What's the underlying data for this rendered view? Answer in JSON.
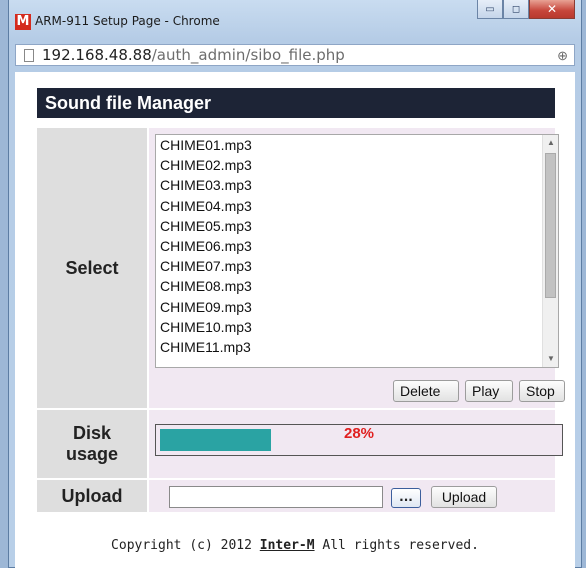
{
  "window": {
    "title": "ARM-911 Setup Page - Chrome",
    "logo_letter": "M",
    "minimize_glyph": "▭",
    "restore_glyph": "◻",
    "close_glyph": "✕"
  },
  "address": {
    "host": "192.168.48.88",
    "path": "/auth_admin/sibo_file.php",
    "zoom_icon": "⊕"
  },
  "page": {
    "title": "Sound file Manager",
    "select_label": "Select",
    "files": [
      "CHIME01.mp3",
      "CHIME02.mp3",
      "CHIME03.mp3",
      "CHIME04.mp3",
      "CHIME05.mp3",
      "CHIME06.mp3",
      "CHIME07.mp3",
      "CHIME08.mp3",
      "CHIME09.mp3",
      "CHIME10.mp3",
      "CHIME11.mp3"
    ],
    "buttons": {
      "delete": "Delete",
      "play": "Play",
      "stop": "Stop"
    },
    "disk": {
      "label_line1": "Disk",
      "label_line2": "usage",
      "percent_text": "28%",
      "fraction": 0.28
    },
    "upload": {
      "label": "Upload",
      "browse": "...",
      "upload_button": "Upload",
      "value": ""
    },
    "footer": {
      "prefix": "Copyright (c) 2012 ",
      "brand": "Inter-M",
      "suffix": " All rights reserved."
    }
  },
  "colors": {
    "title_bar_bg": "#1d2436",
    "progress_fill": "#2aa3a3",
    "progress_text": "#e02020",
    "content_bg": "#f1e8f2",
    "label_bg": "#dedede"
  }
}
